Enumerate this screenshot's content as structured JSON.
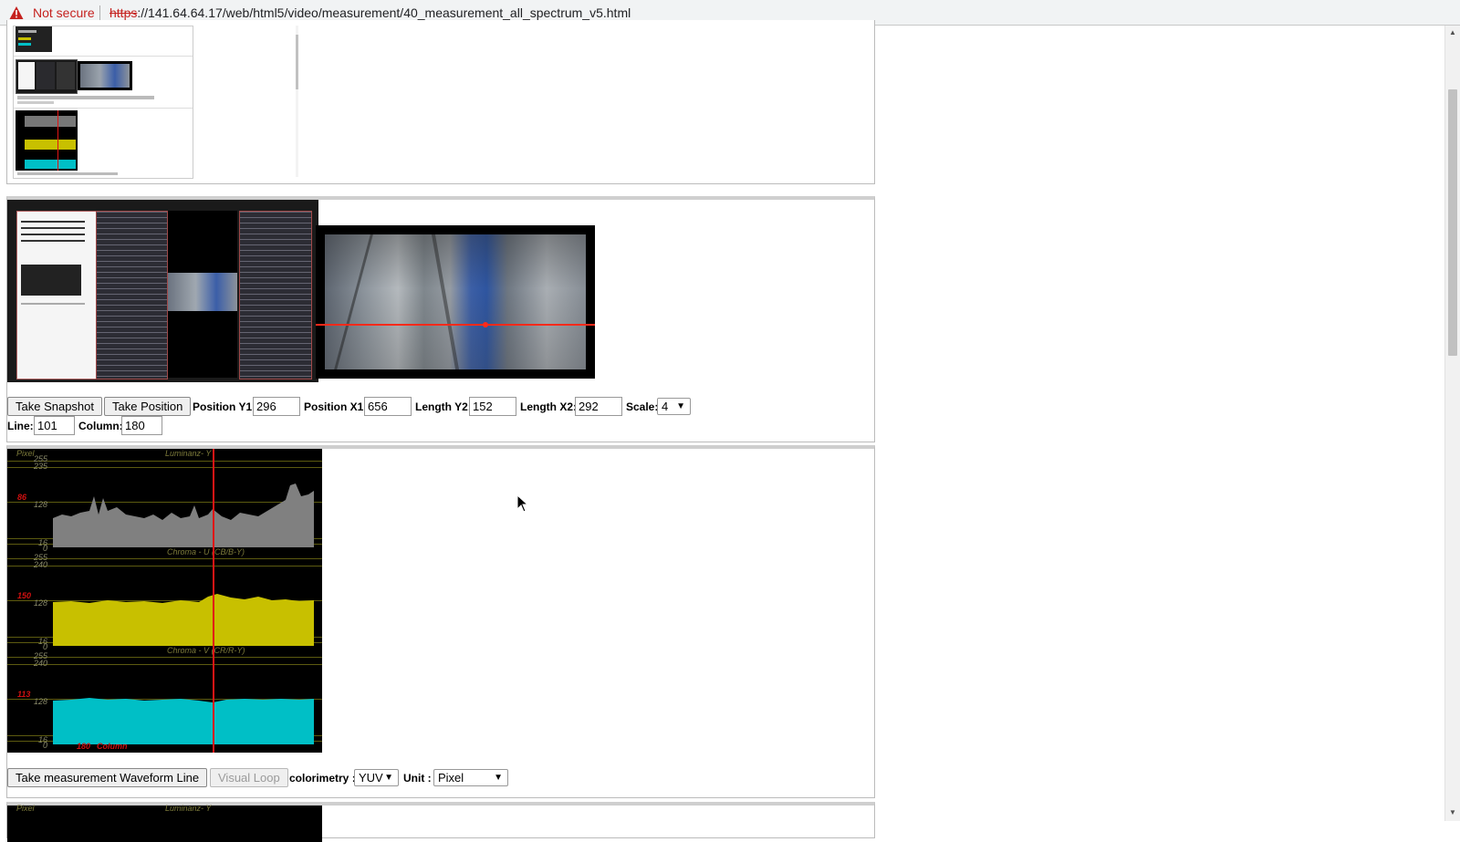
{
  "browser": {
    "security_label": "Not secure",
    "url_scheme": "https",
    "url_rest": "://141.64.64.17/web/html5/video/measurement/40_measurement_all_spectrum_v5.html"
  },
  "snapshot_panel": {
    "take_snapshot": "Take Snapshot",
    "take_position": "Take Position",
    "position_y1": {
      "label": "Position Y1:",
      "value": "296"
    },
    "position_x1": {
      "label": "Position X1:",
      "value": "656"
    },
    "length_y2": {
      "label": "Length Y2:",
      "value": "152"
    },
    "length_x2": {
      "label": "Length X2:",
      "value": "292"
    },
    "scale": {
      "label": "Scale:",
      "value": "4"
    },
    "line": {
      "label": "Line:",
      "value": "101"
    },
    "column": {
      "label": "Column:",
      "value": "180"
    }
  },
  "waveform": {
    "pixel_label": "Pixel",
    "luma_title": "Luminanz- Y",
    "cb_title": "Chroma - U (CB/B-Y)",
    "cr_title": "Chroma - V (CR/R-Y)",
    "luma_ticks": [
      "255",
      "235",
      "128",
      "16",
      "0"
    ],
    "chroma_ticks": [
      "255",
      "240",
      "128",
      "16",
      "0"
    ],
    "luma_marker": "86",
    "cb_marker": "150",
    "cr_marker": "113",
    "column_value": "180",
    "column_label": "Column",
    "colors": {
      "luma": "#808080",
      "cb": "#c8c000",
      "cr": "#00bfc6",
      "cursor": "#e01515"
    }
  },
  "waveform_controls": {
    "take_waveform": "Take measurement Waveform Line",
    "visual_loop": "Visual Loop",
    "colorimetry_label": "colorimetry :",
    "colorimetry_value": "YUV",
    "unit_label": "Unit :",
    "unit_value": "Pixel"
  },
  "next_panel": {
    "pixel_label": "Pixel",
    "luma_title": "Luminanz- Y"
  }
}
